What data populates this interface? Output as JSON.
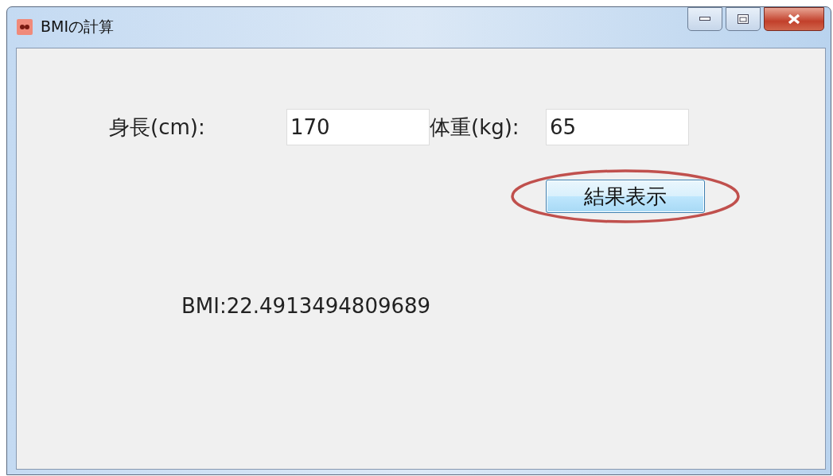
{
  "window": {
    "title": "BMIの計算"
  },
  "fields": [
    {
      "label": "身長(cm):",
      "value": "170"
    },
    {
      "label": "体重(kg):",
      "value": "65"
    }
  ],
  "button": {
    "label": "結果表示"
  },
  "result": "BMI:22.4913494809689"
}
